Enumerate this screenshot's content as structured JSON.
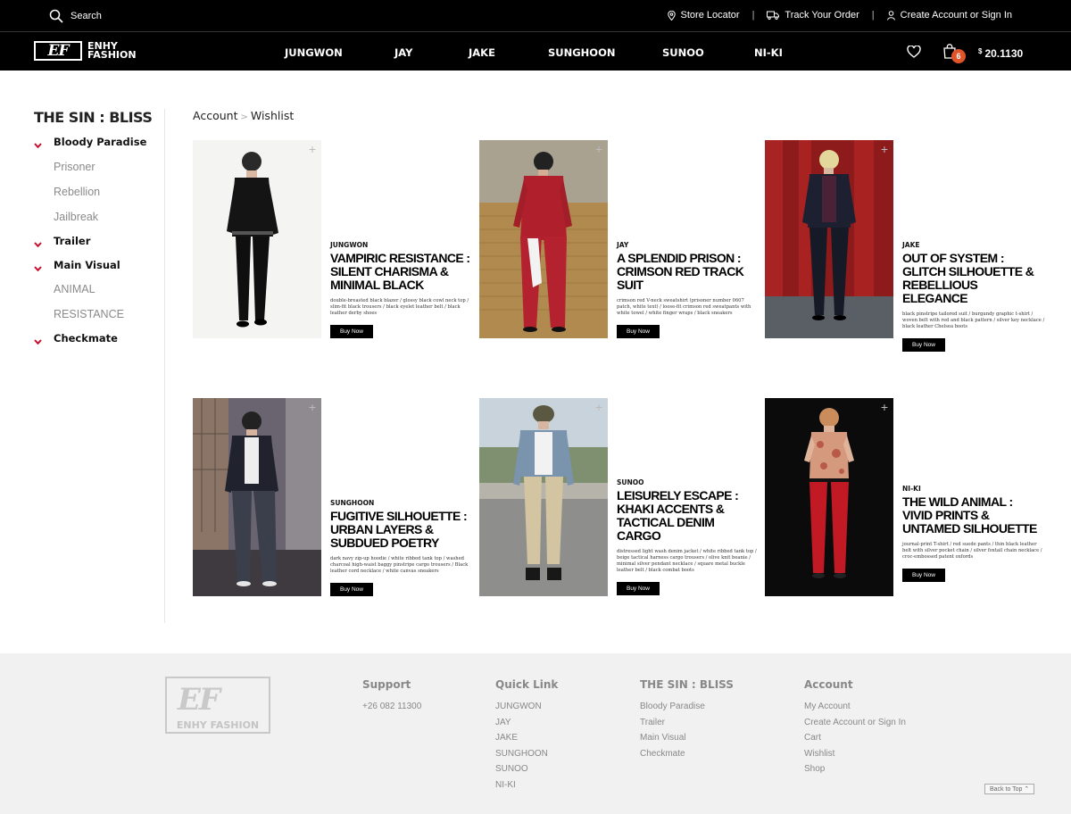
{
  "topbar": {
    "search_label": "Search",
    "store_locator": "Store Locator",
    "track_order": "Track Your Order",
    "account": "Create Account or Sign In",
    "separator": "|"
  },
  "brand": {
    "logo_mark": "EF",
    "logo_line1": "ENHY",
    "logo_line2": "FASHION"
  },
  "nav": {
    "items": [
      "JUNGWON",
      "JAY",
      "JAKE",
      "SUNGHOON",
      "SUNOO",
      "NI-KI"
    ],
    "cart_count": "6",
    "currency": "$",
    "balance": "20.1130"
  },
  "sidebar": {
    "title": "THE SIN : BLISS",
    "items": [
      {
        "label": "Bloody Paradise",
        "type": "main"
      },
      {
        "label": "Prisoner",
        "type": "sub"
      },
      {
        "label": "Rebellion",
        "type": "sub"
      },
      {
        "label": "Jailbreak",
        "type": "sub"
      },
      {
        "label": "Trailer",
        "type": "main"
      },
      {
        "label": "Main Visual",
        "type": "main"
      },
      {
        "label": "ANIMAL",
        "type": "sub"
      },
      {
        "label": "RESISTANCE",
        "type": "sub"
      },
      {
        "label": "Checkmate",
        "type": "main"
      }
    ]
  },
  "breadcrumb": {
    "first": "Account",
    "sep": ">",
    "current": "Wishlist"
  },
  "products": [
    {
      "member": "JUNGWON",
      "title": "VAMPIRIC RESISTANCE : SILENT CHARISMA & MINIMAL BLACK",
      "desc": "double-breasted black blazer / glossy black cowl neck top / slim-fit black trousers / black eyelet leather belt / black leather derby shoes",
      "button": "Buy Now"
    },
    {
      "member": "JAY",
      "title": "A SPLENDID PRISON : CRIMSON RED TRACK SUIT",
      "desc": "crimson red V-neck sweatshirt (prisoner number 0607 patch, white text) / loose-fit crimson red sweatpants with white towel / white finger wraps / black sneakers",
      "button": "Buy Now"
    },
    {
      "member": "JAKE",
      "title": "OUT OF SYSTEM : GLITCH SILHOUETTE & REBELLIOUS ELEGANCE",
      "desc": "black pinstripe tailored suit / burgundy graphic t-shirt / woven belt with red and black pattern / silver key necklace / black leather Chelsea boots",
      "button": "Buy Now"
    },
    {
      "member": "SUNGHOON",
      "title": "FUGITIVE SILHOUETTE : URBAN LAYERS & SUBDUED POETRY",
      "desc": "dark navy zip-up hoodie / white ribbed tank top / washed charcoal high-waist baggy pinstripe cargo trousers / Black leather cord necklace / white canvas sneakers",
      "button": "Buy Now"
    },
    {
      "member": "SUNOO",
      "title": "LEISURELY ESCAPE : KHAKI ACCENTS & TACTICAL DENIM CARGO",
      "desc": "distressed light wash denim jacket / white ribbed tank top / beige tactical harness cargo trousers / olive knit beanie / minimal silver pendant necklace / square metal buckle leather belt / black combat boots",
      "button": "Buy Now"
    },
    {
      "member": "NI-KI",
      "title": "THE WILD ANIMAL : VIVID PRINTS & UNTAMED SILHOUETTE",
      "desc": "journal-print T-shirt / red suede pants / thin black leather belt with silver pocket chain / silver foxtail chain necklace / croc-embossed patent oxfords",
      "button": "Buy Now"
    }
  ],
  "footer": {
    "logo_mark": "EF",
    "logo_name": "ENHY FASHION",
    "support": {
      "title": "Support",
      "links": [
        "+26 082 11300"
      ]
    },
    "quick": {
      "title": "Quick Link",
      "links": [
        "JUNGWON",
        "JAY",
        "JAKE",
        "SUNGHOON",
        "SUNOO",
        "NI-KI"
      ]
    },
    "album": {
      "title": "THE SIN : BLISS",
      "links": [
        "Bloody Paradise",
        "Trailer",
        "Main Visual",
        "Checkmate"
      ]
    },
    "account": {
      "title": "Account",
      "links": [
        "My Account",
        "Create Account or Sign In",
        "Cart",
        "Wishlist",
        "Shop"
      ]
    },
    "back_to_top": "Back to Top"
  },
  "colors": {
    "accent": "#e0542a",
    "chevron": "#c8102e",
    "bar": "#000000",
    "footer_bg": "#f1f1f1"
  },
  "icons": [
    "search-icon",
    "pin-icon",
    "truck-icon",
    "user-icon",
    "heart-icon",
    "bag-icon",
    "chevron-down-icon",
    "plus-icon",
    "caret-up-icon"
  ]
}
